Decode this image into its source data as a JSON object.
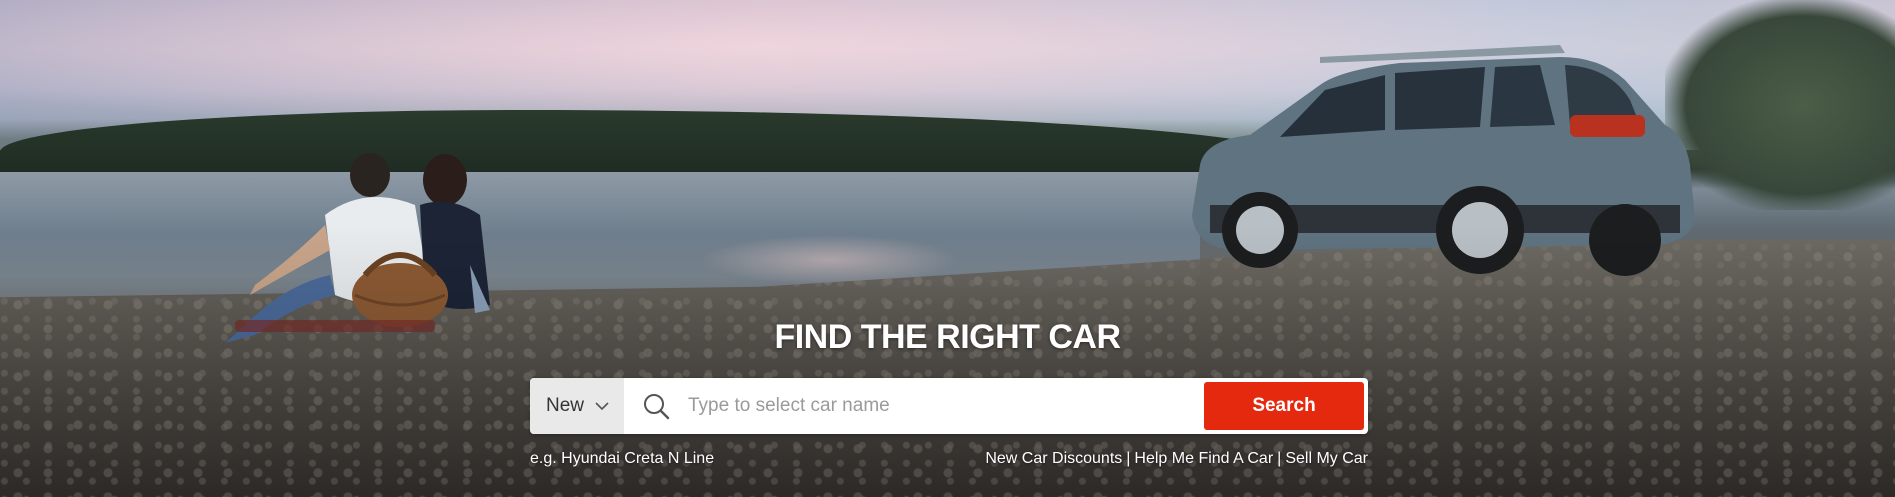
{
  "hero": {
    "headline": "FIND THE RIGHT CAR"
  },
  "search": {
    "type_selected": "New",
    "placeholder": "Type to select car name",
    "button_label": "Search",
    "icon": "search-icon",
    "accent_color": "#e5290f"
  },
  "example_text": "e.g. Hyundai Creta N Line",
  "quick_links": {
    "items": [
      "New Car Discounts",
      "Help Me Find A Car",
      "Sell My Car"
    ],
    "separator": "|"
  }
}
